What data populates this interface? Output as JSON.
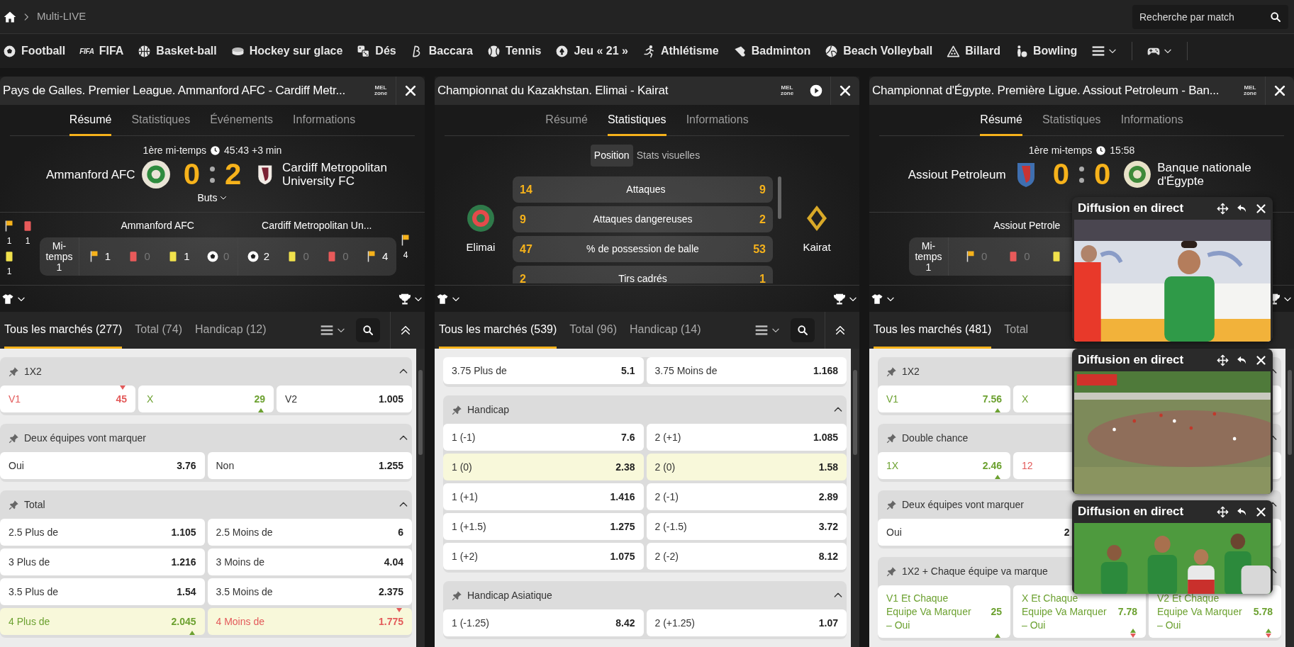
{
  "breadcrumb": {
    "current": "Multi-LIVE"
  },
  "search": {
    "placeholder": "Recherche par match"
  },
  "sports": [
    {
      "label": "Football",
      "kind": "ball"
    },
    {
      "label": "FIFA",
      "kind": "logo",
      "logo": "FIFA"
    },
    {
      "label": "Basket-ball",
      "kind": "basketball"
    },
    {
      "label": "Hockey sur glace",
      "kind": "puck"
    },
    {
      "label": "Dés",
      "kind": "dice"
    },
    {
      "label": "Baccara",
      "kind": "card"
    },
    {
      "label": "Tennis",
      "kind": "tennis"
    },
    {
      "label": "Jeu « 21 »",
      "kind": "spade"
    },
    {
      "label": "Athlétisme",
      "kind": "runner"
    },
    {
      "label": "Badminton",
      "kind": "shuttle"
    },
    {
      "label": "Beach Volleyball",
      "kind": "volley"
    },
    {
      "label": "Billard",
      "kind": "pool"
    },
    {
      "label": "Bowling",
      "kind": "bowling"
    }
  ],
  "panels": [
    {
      "title": "Pays de Galles. Premier League. Ammanford AFC - Cardiff Metr...",
      "logo": "MEL zone",
      "play": false,
      "tabs": [
        {
          "label": "Résumé",
          "selected": true
        },
        {
          "label": "Statistiques",
          "selected": false
        },
        {
          "label": "Événements",
          "selected": false
        },
        {
          "label": "Informations",
          "selected": false
        }
      ],
      "summary": {
        "kind": "score",
        "period": "1ère mi-temps",
        "time": "45:43 +3 min",
        "home": "Ammanford AFC",
        "away": "Cardiff Metropolitan University FC",
        "home_score": "0",
        "away_score": "2",
        "toggle": "Buts",
        "side_home": [
          {
            "kind": "flag",
            "value": "1"
          },
          {
            "kind": "red",
            "value": "1"
          },
          {
            "kind": "yellow",
            "value": "1"
          }
        ],
        "side_away": [
          {
            "kind": "flag",
            "value": "4"
          }
        ],
        "home_label": "Ammanford AFC",
        "away_label": "Cardiff Metropolitan Un...",
        "row_label": "Mi-temps 1",
        "home_items": [
          {
            "kind": "flag",
            "value": "1",
            "muted": false
          },
          {
            "kind": "red",
            "value": "0",
            "muted": true
          },
          {
            "kind": "yellow",
            "value": "1",
            "muted": false
          },
          {
            "kind": "ball",
            "value": "0",
            "muted": true
          }
        ],
        "away_items": [
          {
            "kind": "ball",
            "value": "2",
            "muted": false
          },
          {
            "kind": "yellow",
            "value": "0",
            "muted": true
          },
          {
            "kind": "red",
            "value": "0",
            "muted": true
          },
          {
            "kind": "flag",
            "value": "4",
            "muted": false
          }
        ]
      },
      "market_tabs": [
        {
          "label": "Tous les marchés (277)",
          "selected": true
        },
        {
          "label": "Total (74)",
          "selected": false
        },
        {
          "label": "Handicap (12)",
          "selected": false
        }
      ],
      "market_tools": true,
      "markets": [
        {
          "title": "1X2",
          "expanded": true,
          "rows": [
            [
              {
                "label": "V1",
                "odds": "45",
                "highlight": false,
                "rising": false,
                "falling": true
              },
              {
                "label": "X",
                "odds": "29",
                "highlight": false,
                "rising": true,
                "falling": false
              },
              {
                "label": "V2",
                "odds": "1.005",
                "highlight": false,
                "rising": false,
                "falling": false
              }
            ]
          ]
        },
        {
          "title": "Deux équipes vont marquer",
          "expanded": true,
          "rows": [
            [
              {
                "label": "Oui",
                "odds": "3.76",
                "highlight": false,
                "rising": false,
                "falling": false
              },
              {
                "label": "Non",
                "odds": "1.255",
                "highlight": false,
                "rising": false,
                "falling": false
              }
            ]
          ]
        },
        {
          "title": "Total",
          "expanded": true,
          "rows": [
            [
              {
                "label": "2.5 Plus de",
                "odds": "1.105",
                "highlight": false,
                "rising": false,
                "falling": false
              },
              {
                "label": "2.5 Moins de",
                "odds": "6",
                "highlight": false,
                "rising": false,
                "falling": false
              }
            ],
            [
              {
                "label": "3 Plus de",
                "odds": "1.216",
                "highlight": false,
                "rising": false,
                "falling": false
              },
              {
                "label": "3 Moins de",
                "odds": "4.04",
                "highlight": false,
                "rising": false,
                "falling": false
              }
            ],
            [
              {
                "label": "3.5 Plus de",
                "odds": "1.54",
                "highlight": false,
                "rising": false,
                "falling": false
              },
              {
                "label": "3.5 Moins de",
                "odds": "2.375",
                "highlight": false,
                "rising": false,
                "falling": false
              }
            ],
            [
              {
                "label": "4 Plus de",
                "odds": "2.045",
                "highlight": true,
                "rising": true,
                "falling": false
              },
              {
                "label": "4 Moins de",
                "odds": "1.775",
                "highlight": true,
                "rising": false,
                "falling": true
              }
            ]
          ]
        }
      ]
    },
    {
      "title": "Championnat du Kazakhstan. Elimai - Kairat",
      "logo": "MEL zone",
      "play": true,
      "tabs": [
        {
          "label": "Résumé",
          "selected": false
        },
        {
          "label": "Statistiques",
          "selected": true
        },
        {
          "label": "Informations",
          "selected": false
        }
      ],
      "summary": {
        "kind": "stats",
        "subtabs": [
          {
            "label": "Position",
            "selected": true
          },
          {
            "label": "Stats visuelles",
            "selected": false
          }
        ],
        "home": "Elimai",
        "away": "Kairat",
        "rows": [
          {
            "home": "14",
            "label": "Attaques",
            "away": "9"
          },
          {
            "home": "9",
            "label": "Attaques dangereuses",
            "away": "2"
          },
          {
            "home": "47",
            "label": "% de possession de balle",
            "away": "53"
          },
          {
            "home": "2",
            "label": "Tirs cadrés",
            "away": "1"
          }
        ]
      },
      "market_tabs": [
        {
          "label": "Tous les marchés (539)",
          "selected": true
        },
        {
          "label": "Total (96)",
          "selected": false
        },
        {
          "label": "Handicap (14)",
          "selected": false
        }
      ],
      "market_tools": true,
      "markets": [
        {
          "expanded": true,
          "rows": [
            [
              {
                "label": "3.75 Plus de",
                "odds": "5.1",
                "highlight": false,
                "rising": false,
                "falling": false
              },
              {
                "label": "3.75 Moins de",
                "odds": "1.168",
                "highlight": false,
                "rising": false,
                "falling": false
              }
            ]
          ]
        },
        {
          "title": "Handicap",
          "expanded": true,
          "rows": [
            [
              {
                "label": "1 (-1)",
                "odds": "7.6",
                "highlight": false,
                "rising": false,
                "falling": false
              },
              {
                "label": "2 (+1)",
                "odds": "1.085",
                "highlight": false,
                "rising": false,
                "falling": false
              }
            ],
            [
              {
                "label": "1 (0)",
                "odds": "2.38",
                "highlight": true,
                "rising": false,
                "falling": false
              },
              {
                "label": "2 (0)",
                "odds": "1.58",
                "highlight": true,
                "rising": false,
                "falling": false
              }
            ],
            [
              {
                "label": "1 (+1)",
                "odds": "1.416",
                "highlight": false,
                "rising": false,
                "falling": false
              },
              {
                "label": "2 (-1)",
                "odds": "2.89",
                "highlight": false,
                "rising": false,
                "falling": false
              }
            ],
            [
              {
                "label": "1 (+1.5)",
                "odds": "1.275",
                "highlight": false,
                "rising": false,
                "falling": false
              },
              {
                "label": "2 (-1.5)",
                "odds": "3.72",
                "highlight": false,
                "rising": false,
                "falling": false
              }
            ],
            [
              {
                "label": "1 (+2)",
                "odds": "1.075",
                "highlight": false,
                "rising": false,
                "falling": false
              },
              {
                "label": "2 (-2)",
                "odds": "8.12",
                "highlight": false,
                "rising": false,
                "falling": false
              }
            ]
          ]
        },
        {
          "title": "Handicap Asiatique",
          "expanded": true,
          "rows": [
            [
              {
                "label": "1 (-1.25)",
                "odds": "8.42",
                "highlight": false,
                "rising": false,
                "falling": false
              },
              {
                "label": "2 (+1.25)",
                "odds": "1.07",
                "highlight": false,
                "rising": false,
                "falling": false
              }
            ]
          ]
        }
      ]
    },
    {
      "title": "Championnat d'Égypte. Première Ligue. Assiout Petroleum - Ban...",
      "logo": "MEL zone",
      "play": false,
      "tabs": [
        {
          "label": "Résumé",
          "selected": true
        },
        {
          "label": "Statistiques",
          "selected": false
        },
        {
          "label": "Informations",
          "selected": false
        }
      ],
      "summary": {
        "kind": "score",
        "period": "1ère mi-temps",
        "time": "15:58",
        "home": "Assiout Petroleum",
        "away": "Banque nationale d'Égypte",
        "home_score": "0",
        "away_score": "0",
        "home_label": "Assiout Petrole",
        "row_label": "Mi-temps 1",
        "home_items": [
          {
            "kind": "flag",
            "value": "0",
            "muted": true
          },
          {
            "kind": "red",
            "value": "0",
            "muted": true
          },
          {
            "kind": "yellow"
          }
        ]
      },
      "market_tabs": [
        {
          "label": "Tous les marchés (481)",
          "selected": true
        },
        {
          "label": "Total",
          "selected": false
        }
      ],
      "market_tools": false,
      "markets": [
        {
          "title": "1X2",
          "expanded": true,
          "rows": [
            [
              {
                "label": "V1",
                "odds": "7.56",
                "highlight": false,
                "rising": true,
                "falling": false
              },
              {
                "label": "X",
                "highlight": false,
                "rising": true
              },
              {
                "highlight": false
              }
            ]
          ]
        },
        {
          "title": "Double chance",
          "expanded": true,
          "rows": [
            [
              {
                "label": "1X",
                "odds": "2.46",
                "highlight": false,
                "rising": true,
                "falling": false
              },
              {
                "label": "12",
                "highlight": false,
                "rising": false,
                "falling": true
              },
              {
                "highlight": false
              }
            ]
          ]
        },
        {
          "title": "Deux équipes vont marquer",
          "expanded": true,
          "rows": [
            [
              {
                "label": "Oui",
                "odds": "2",
                "highlight": false,
                "rising": false,
                "falling": false
              },
              {
                "highlight": false
              }
            ]
          ]
        },
        {
          "title": "1X2 + Chaque équipe va marque",
          "expanded": true,
          "rows": [
            [
              {
                "label": "V1 Et Chaque Equipe Va Marquer – Oui",
                "odds": "25",
                "highlight": false,
                "rising": true,
                "falling": false
              },
              {
                "label": "X Et Chaque Equipe Va Marquer – Oui",
                "odds": "7.78",
                "highlight": false,
                "rising": true,
                "falling": true
              },
              {
                "label": "V2 Et Chaque Equipe Va Marquer – Oui",
                "odds": "5.78",
                "highlight": false,
                "rising": true,
                "falling": true
              }
            ]
          ]
        }
      ]
    }
  ],
  "streams": [
    {
      "title": "Diffusion en direct"
    },
    {
      "title": "Diffusion en direct"
    },
    {
      "title": "Diffusion en direct"
    }
  ]
}
